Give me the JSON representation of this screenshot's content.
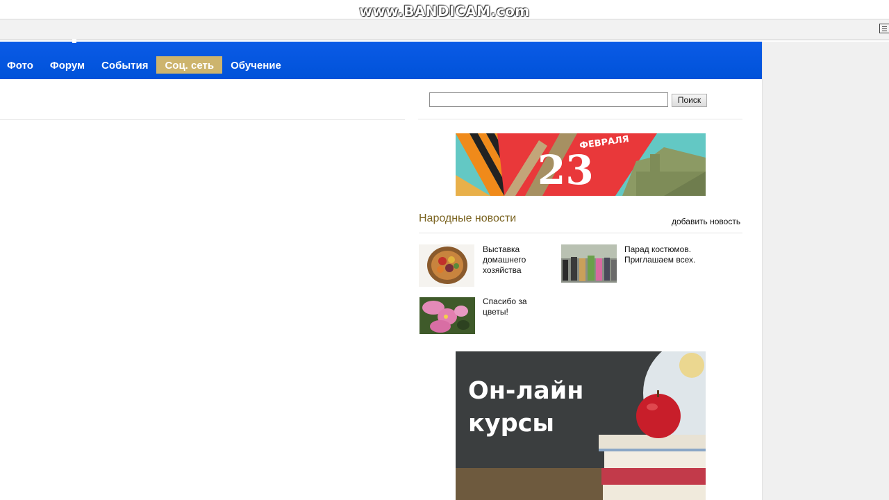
{
  "recorder": {
    "watermark": "www.BANDICAM.com"
  },
  "nav": {
    "items": [
      {
        "label": "Фото",
        "active": false
      },
      {
        "label": "Форум",
        "active": false
      },
      {
        "label": "События",
        "active": false
      },
      {
        "label": "Соц. сеть",
        "active": true
      },
      {
        "label": "Обучение",
        "active": false
      }
    ]
  },
  "search": {
    "value": "",
    "button_label": "Поиск"
  },
  "banner_23feb": {
    "day": "23",
    "month": "ФЕВРАЛЯ"
  },
  "news": {
    "heading": "Народные новости",
    "add_link": "добавить новость",
    "items": [
      {
        "title": "Выставка домашнего хозяйства",
        "thumb": "food-basket-photo"
      },
      {
        "title": "Парад костюмов. Приглашаем всех.",
        "thumb": "costume-parade-photo"
      },
      {
        "title": "Спасибо за цветы!",
        "thumb": "pink-flowers-photo"
      }
    ]
  },
  "courses_banner": {
    "line1": "Он-лайн",
    "line2": "курсы"
  },
  "colors": {
    "nav_blue": "#0052d9",
    "nav_active": "#cdb46d",
    "news_heading": "#7a6320"
  }
}
